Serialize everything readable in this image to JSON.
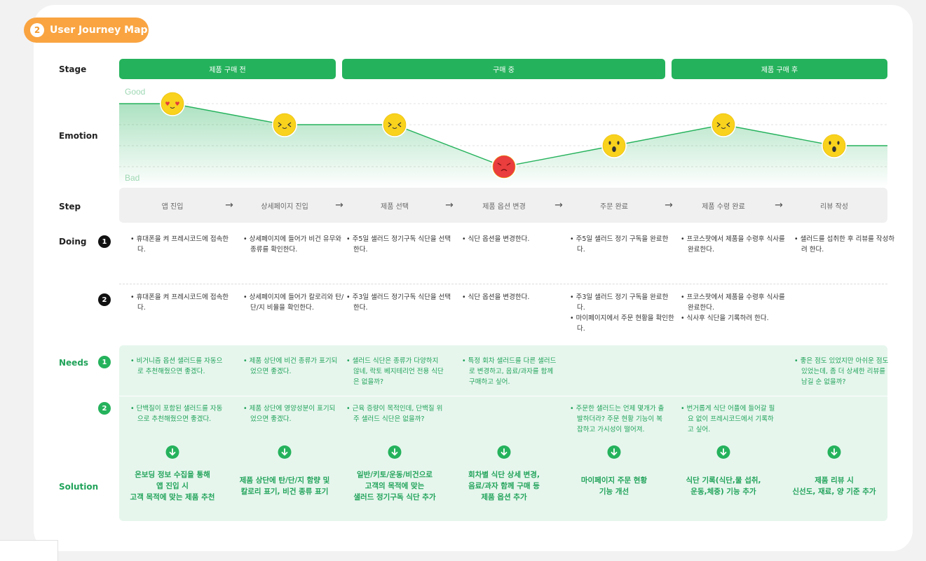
{
  "header": {
    "number": "2",
    "title": "User Journey Map"
  },
  "row_labels": {
    "stage": "Stage",
    "emotion": "Emotion",
    "step": "Step",
    "doing": "Doing",
    "needs": "Needs",
    "solution": "Solution"
  },
  "stages": [
    "제품 구매 전",
    "구매 중",
    "제품 구매 후"
  ],
  "emotion": {
    "good_label": "Good",
    "bad_label": "Bad",
    "scale_note": "level 1 = Good (top), 4 = Bad (bottom)",
    "points": [
      {
        "step": "앱 진입",
        "level": 1,
        "face": "love"
      },
      {
        "step": "상세페이지 진입",
        "level": 2,
        "face": "happy"
      },
      {
        "step": "제품 선택",
        "level": 2,
        "face": "happy"
      },
      {
        "step": "제품 옵션 변경",
        "level": 4,
        "face": "angry"
      },
      {
        "step": "주문 완료",
        "level": 3,
        "face": "surprised"
      },
      {
        "step": "제품 수령 완료",
        "level": 2,
        "face": "happy"
      },
      {
        "step": "리뷰 작성",
        "level": 3,
        "face": "surprised"
      }
    ],
    "colors": {
      "line": "#25b25c",
      "fill": "#25b25c",
      "face": "#f8d21c",
      "angry": "#ea3d3d"
    }
  },
  "steps": [
    "앱 진입",
    "상세페이지 진입",
    "제품 선택",
    "제품 옵션 변경",
    "주문 완료",
    "제품 수령 완료",
    "리뷰 작성"
  ],
  "arrow_glyph": "→",
  "doing": {
    "row1_badge": "1",
    "row2_badge": "2",
    "row1": [
      [
        "휴대폰을 켜 프레시코드에 접속한다."
      ],
      [
        "상세페이지에 들어가 비건 유무와 종류를 확인한다."
      ],
      [
        "주5일 샐러드 정기구독 식단을 선택한다."
      ],
      [
        "식단 옵션을 변경한다."
      ],
      [
        "주5일 샐러드 정기 구독을 완료한다."
      ],
      [
        "프코스팟에서 제품을 수령후 식사를 완료한다."
      ],
      [
        "샐러드를 섭취한 후 리뷰를 작성하려 한다."
      ]
    ],
    "row2": [
      [
        "휴대폰을 켜 프레시코드에 접속한다."
      ],
      [
        "상세페이지에 들어가 칼로리와 탄/단/지 비율을 확인한다."
      ],
      [
        "주3일 샐러드 정기구독 식단을 선택한다."
      ],
      [
        "식단 옵션을 변경한다."
      ],
      [
        "주3일 샐러드 정기 구독을 완료한다.",
        "마이페이지에서 주문 현황을 확인한다."
      ],
      [
        "프코스팟에서 제품을 수령후 식사를 완료한다.",
        "식사후 식단을 기록하려 한다."
      ],
      []
    ]
  },
  "needs": {
    "row1_badge": "1",
    "row2_badge": "2",
    "row1": [
      "비거니즘 옵션 샐러드를 자동으로 추천해줬으면 좋겠다.",
      "제품 상단에 비건 종류가 표기되었으면 좋겠다.",
      "샐러드 식단은 종류가 다양하지 않네, 락토 베지테리언 전용 식단은 없을까?",
      "특정 회차 샐러드를 다른 샐러드로 변경하고, 음료/과자를 함께 구매하고 싶어.",
      "",
      "",
      "좋은 점도 있었지만 아쉬운 점도 있었는데, 좀 더 상세한 리뷰를 남길 순 없을까?"
    ],
    "row2": [
      "단백질이 포함된 샐러드를 자동으로 추천해줬으면 좋겠다.",
      "제품 상단에 영양성분이 표기되었으면 좋겠다.",
      "근육 증량이 목적인데, 단백질 위주 샐러드 식단은 없을까?",
      "",
      "주문한 샐러드는 언제 몇개가 출발하더라? 주문 현황 기능이 복잡하고 가시성이 떨어져.",
      "번거롭게 식단 어플에 들어갈 필요 없이 프레시코드에서 기록하고 싶어.",
      ""
    ]
  },
  "solutions": [
    [
      "온보딩 정보 수집을 통해",
      "앱 진입 시",
      "고객 목적에 맞는 제품 추천"
    ],
    [
      "제품 상단에 탄/단/지 함량 및",
      "칼로리 표기, 비건 종류 표기"
    ],
    [
      "일반/키토/운동/비건으로",
      "고객의 목적에 맞는",
      "샐러드 정기구독 식단 추가"
    ],
    [
      "회차별 식단 상세 변경,",
      "음료/과자 함께 구매 등",
      "제품 옵션 추가"
    ],
    [
      "마이페이지 주문 현황",
      "기능 개선"
    ],
    [
      "식단 기록(식단,물 섭취,",
      "운동,체중) 기능 추가"
    ],
    [
      "제품 리뷰 시",
      "신선도, 재료, 양 기준 추가"
    ]
  ],
  "icons": {
    "solution_marker": "arrow-down-circle-icon"
  }
}
